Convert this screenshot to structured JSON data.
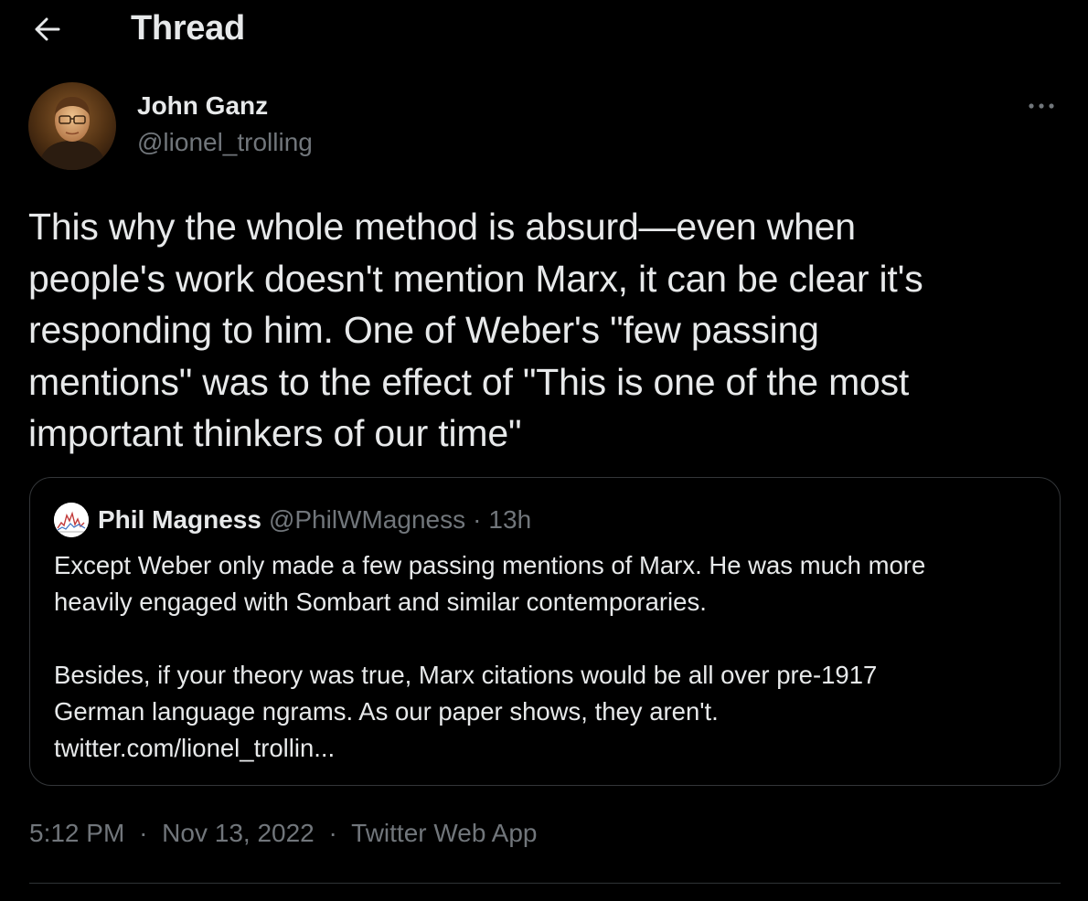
{
  "header": {
    "title": "Thread",
    "back_icon": "arrow-left-icon"
  },
  "tweet": {
    "author": {
      "name": "John Ganz",
      "handle": "@lionel_trolling"
    },
    "more_icon": "more-horizontal-icon",
    "text": "This why the whole method is absurd—even when\npeople's work doesn't mention Marx, it can be clear it's\nresponding to him. One of Weber's \"few passing\nmentions\" was to the effect of \"This is one of the most\nimportant thinkers of our time\"",
    "quoted": {
      "name": "Phil Magness",
      "handle": "@PhilWMagness",
      "separator": "·",
      "time": "13h",
      "text": "Except Weber only made a few passing mentions of Marx. He was much more\nheavily engaged with Sombart and similar contemporaries.\n\nBesides, if your theory was true, Marx citations would be all over pre-1917\nGerman language ngrams. As our paper shows, they aren't.\ntwitter.com/lionel_trollin..."
    },
    "meta": {
      "time": "5:12 PM",
      "date": "Nov 13, 2022",
      "source": "Twitter Web App",
      "separator": "·"
    }
  },
  "colors": {
    "background": "#000000",
    "text_primary": "#e7e9ea",
    "text_secondary": "#71767b",
    "border": "#333639"
  }
}
